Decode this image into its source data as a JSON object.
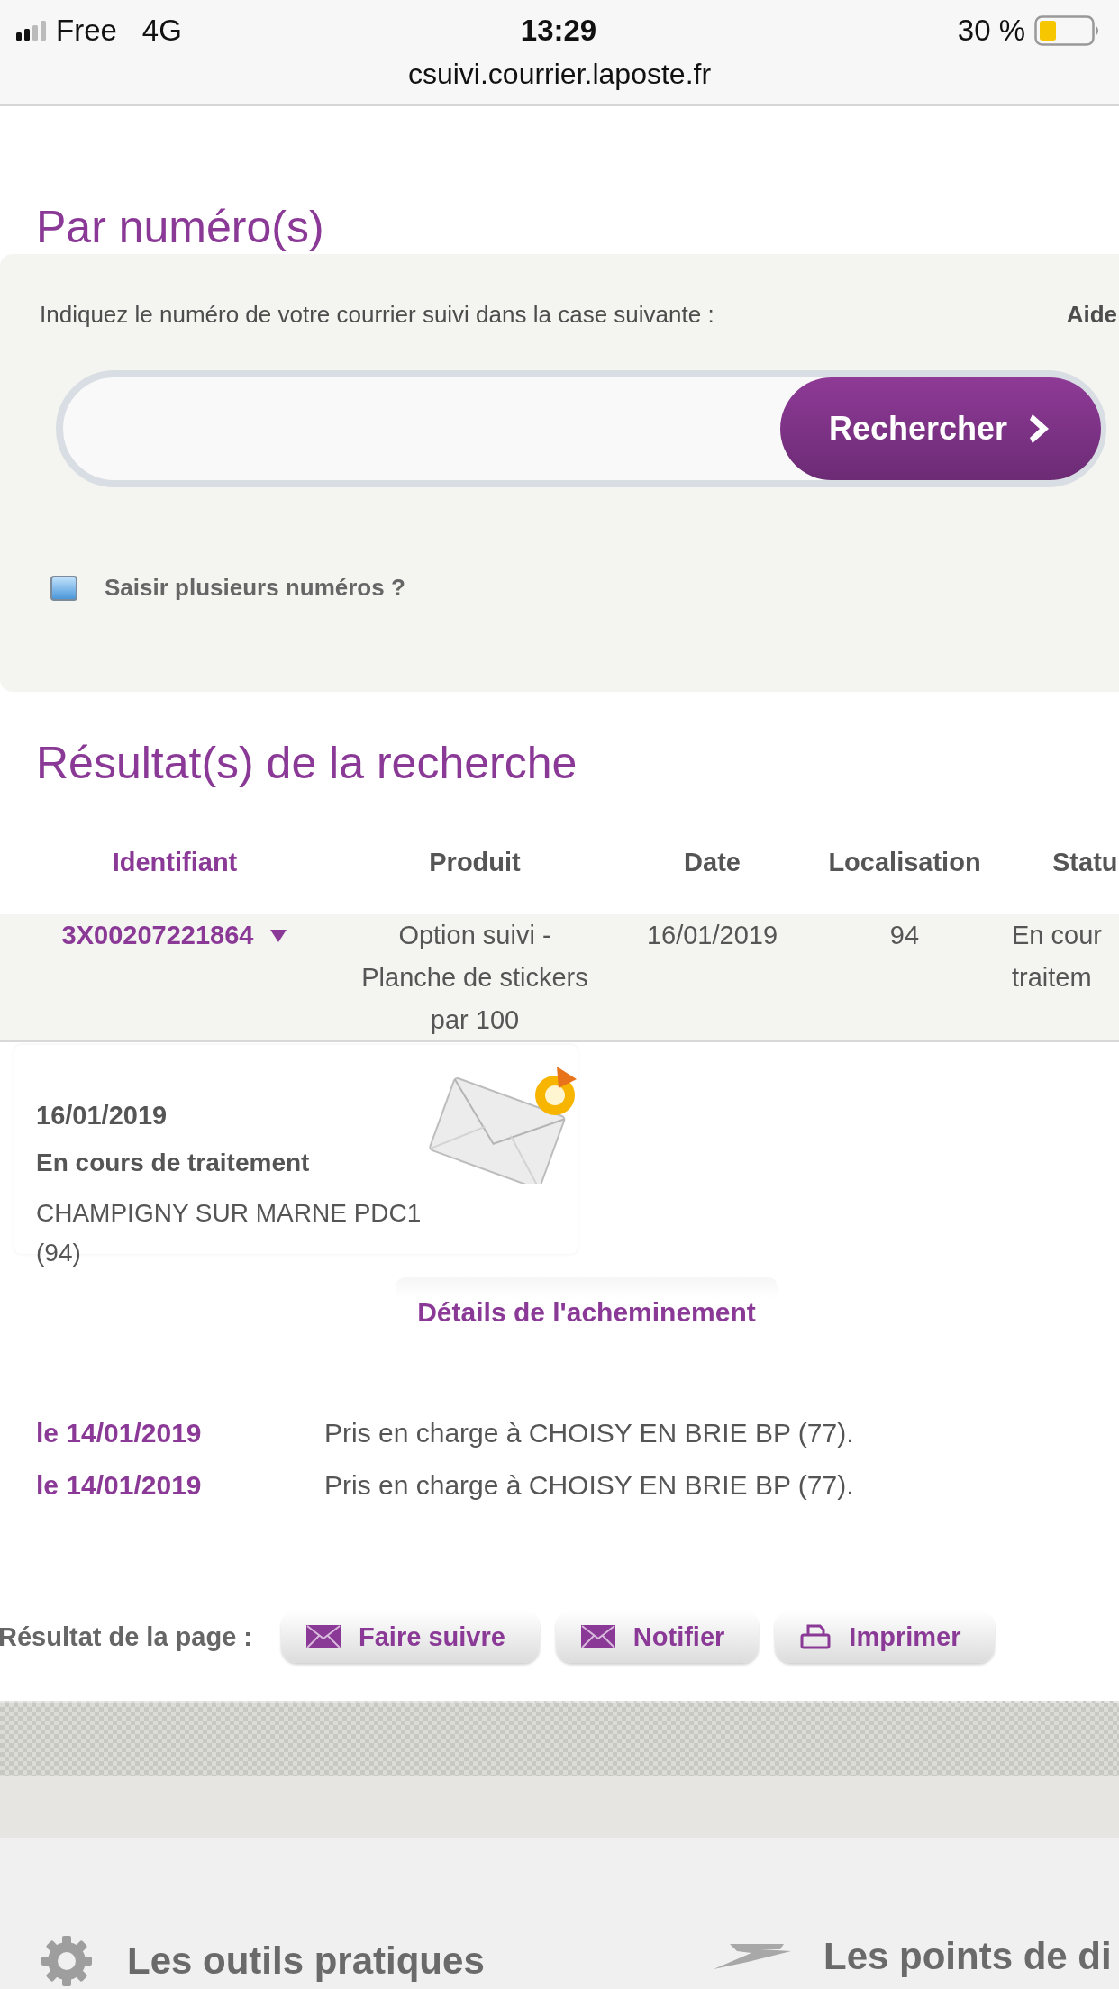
{
  "status_bar": {
    "carrier": "Free",
    "network": "4G",
    "time": "13:29",
    "battery": "30 %"
  },
  "address_bar": {
    "url": "csuivi.courrier.laposte.fr"
  },
  "search_section": {
    "title": "Par numéro(s)",
    "instruction": "Indiquez le numéro de votre courrier suivi dans la case suivante :",
    "help_link": "Aide",
    "search_button": "Rechercher",
    "multiple_checkbox": {
      "label": "Saisir plusieurs numéros ?",
      "checked": false
    }
  },
  "results": {
    "title": "Résultat(s) de la recherche",
    "table": {
      "columns": [
        {
          "label": "Identifiant",
          "selected": true
        },
        {
          "label": "Produit",
          "selected": false
        },
        {
          "label": "Date",
          "selected": false
        },
        {
          "label": "Localisation",
          "selected": false
        },
        {
          "label": "Statu",
          "selected": false
        }
      ],
      "rows": [
        {
          "expanded": true,
          "cells": [
            "3X00207221864",
            "Option suivi - Planche de stickers par 100",
            "16/01/2019",
            "94",
            "En cour traitem"
          ]
        }
      ]
    }
  },
  "latest_event": {
    "date": "16/01/2019",
    "status": "En cours de traitement",
    "location": "CHAMPIGNY SUR MARNE PDC1 (94)"
  },
  "details_link": "Détails de l'acheminement",
  "events": [
    {
      "date": "le 14/01/2019",
      "text": "Pris en charge à CHOISY EN BRIE BP (77)."
    },
    {
      "date": "le 14/01/2019",
      "text": "Pris en charge à CHOISY EN BRIE BP (77)."
    }
  ],
  "page_actions": {
    "label": "Résultat de la page :",
    "buttons": [
      {
        "label": "Faire suivre",
        "kind": "mail"
      },
      {
        "label": "Notifier",
        "kind": "mail"
      },
      {
        "label": "Imprimer",
        "kind": "print"
      }
    ]
  },
  "footer": {
    "sections": [
      {
        "title": "Les outils pratiques",
        "kind": "tools"
      },
      {
        "title": "Les points de di",
        "kind": "locations"
      }
    ]
  }
}
